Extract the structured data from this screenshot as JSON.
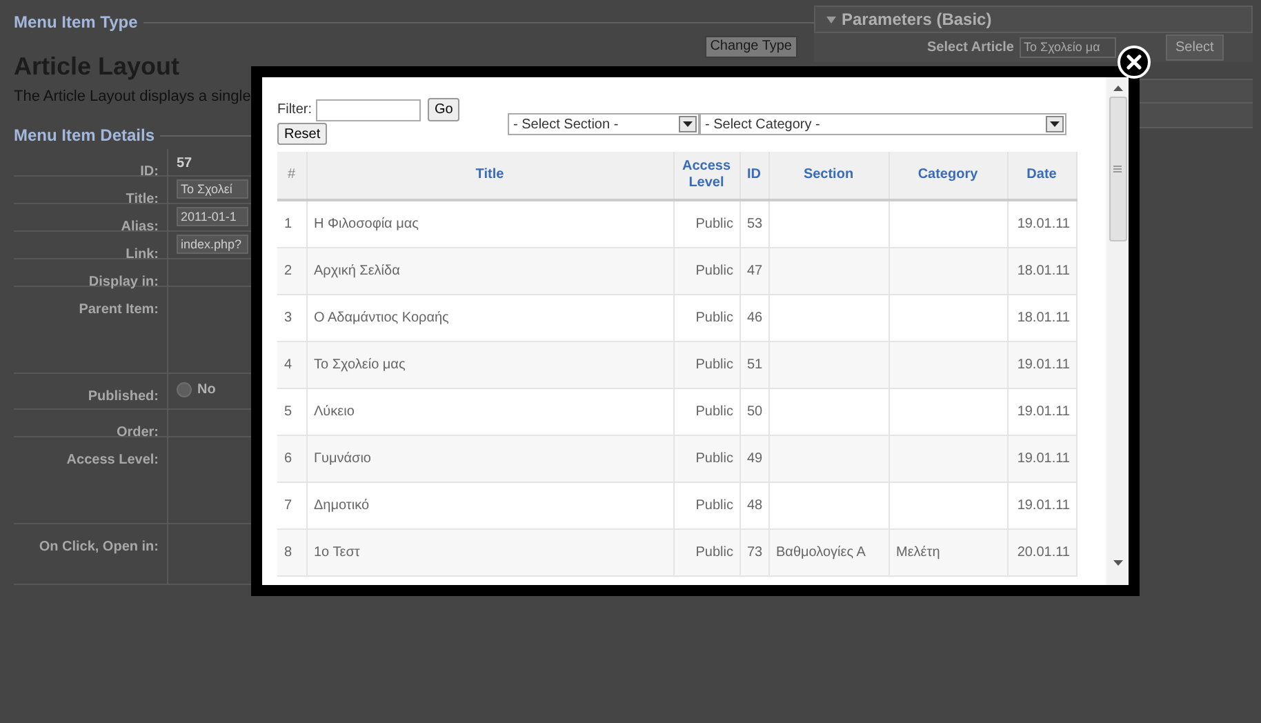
{
  "page": {
    "type_legend": "Menu Item Type",
    "layout_title": "Article Layout",
    "description": "The Article Layout displays a single",
    "change_type_button": "Change Type",
    "details_legend": "Menu Item Details",
    "fields": [
      {
        "label": "ID:",
        "value": "57",
        "kind": "text"
      },
      {
        "label": "Title:",
        "value": "Το Σχολεί",
        "kind": "input"
      },
      {
        "label": "Alias:",
        "value": "2011-01-1",
        "kind": "input"
      },
      {
        "label": "Link:",
        "value": "index.php?",
        "kind": "input"
      },
      {
        "label": "Display in:",
        "kind": "empty"
      },
      {
        "label": "Parent Item:",
        "kind": "tall"
      },
      {
        "label": "Published:",
        "kind": "radio",
        "options": [
          {
            "label": "No",
            "selected": false
          }
        ]
      },
      {
        "label": "Order:",
        "kind": "empty"
      },
      {
        "label": "Access Level:",
        "kind": "tall"
      },
      {
        "label": "On Click, Open in:",
        "kind": "empty"
      }
    ],
    "parameters": {
      "title": "Parameters (Basic)",
      "select_article_label": "Select Article",
      "article_value": "Το Σχολείο μα",
      "select_button": "Select"
    }
  },
  "modal": {
    "filter_label": "Filter:",
    "go_button": "Go",
    "reset_button": "Reset",
    "section_select": "- Select Section -",
    "category_select": "- Select Category -",
    "table": {
      "columns": [
        "#",
        "Title",
        "Access Level",
        "ID",
        "Section",
        "Category",
        "Date"
      ],
      "rows": [
        [
          "1",
          "Η Φιλοσοφία μας",
          "Public",
          "53",
          "",
          "",
          "19.01.11"
        ],
        [
          "2",
          "Αρχική Σελίδα",
          "Public",
          "47",
          "",
          "",
          "18.01.11"
        ],
        [
          "3",
          "Ο Αδαμάντιος Κοραής",
          "Public",
          "46",
          "",
          "",
          "18.01.11"
        ],
        [
          "4",
          "Το Σχολείο μας",
          "Public",
          "51",
          "",
          "",
          "19.01.11"
        ],
        [
          "5",
          "Λύκειο",
          "Public",
          "50",
          "",
          "",
          "19.01.11"
        ],
        [
          "6",
          "Γυμνάσιο",
          "Public",
          "49",
          "",
          "",
          "19.01.11"
        ],
        [
          "7",
          "Δημοτικό",
          "Public",
          "48",
          "",
          "",
          "19.01.11"
        ],
        [
          "8",
          "1ο Τεστ",
          "Public",
          "73",
          "Βαθμολογίες Α",
          "Μελέτη",
          "20.01.11"
        ]
      ]
    }
  }
}
